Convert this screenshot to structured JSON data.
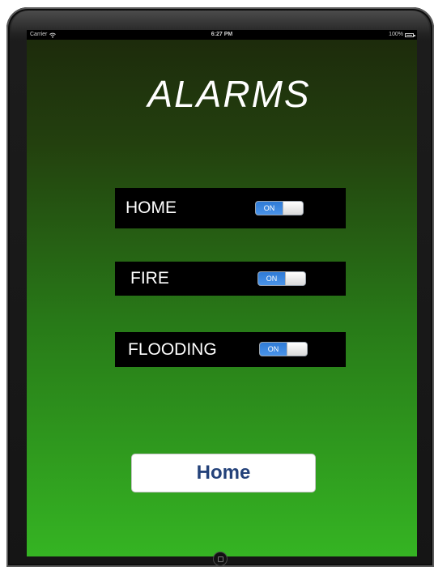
{
  "status_bar": {
    "carrier": "Carrier",
    "time": "6:27 PM",
    "battery": "100%",
    "wifi_icon": "wifi-icon",
    "battery_icon": "battery-icon"
  },
  "title": "ALARMS",
  "alarms": [
    {
      "label": "HOME",
      "switch_text": "ON",
      "on": true
    },
    {
      "label": "FIRE",
      "switch_text": "ON",
      "on": true
    },
    {
      "label": "FLOODING",
      "switch_text": "ON",
      "on": true
    }
  ],
  "home_button": {
    "label": "Home"
  },
  "colors": {
    "switch_on": "#2f7bd6",
    "button_text": "#24427a",
    "gradient_top": "#1d2b0c",
    "gradient_bottom": "#35b423"
  }
}
